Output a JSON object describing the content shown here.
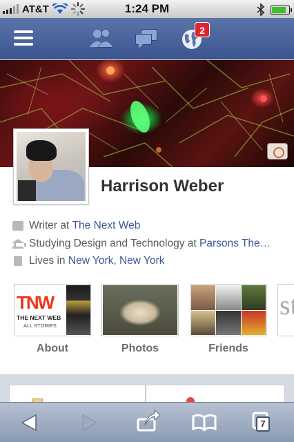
{
  "status_bar": {
    "carrier": "AT&T",
    "time": "1:24 PM",
    "battery_percent": 0.85
  },
  "top_bar": {
    "menu_icon": "hamburger-menu-icon",
    "friends_icon": "friend-requests-icon",
    "messages_icon": "messages-icon",
    "notifications_icon": "globe-notifications-icon",
    "notification_count": "2",
    "accent_color": "#3b5998"
  },
  "profile": {
    "name": "Harrison Weber",
    "work_prefix": "Writer at",
    "work_link": "The Next Web",
    "study_prefix": "Studying Design and Technology at",
    "study_link": "Parsons The…",
    "lives_prefix": "Lives in",
    "lives_link": "New York, New York"
  },
  "tiles": {
    "about_label": "About",
    "photos_label": "Photos",
    "friends_label": "Friends",
    "about_thumb": {
      "logo": "TNW",
      "line1": "THE NEXT WEB",
      "line2": "ALL STORIES"
    },
    "more_thumb_text": "sty"
  },
  "safari_toolbar": {
    "back_icon": "back-arrow-icon",
    "forward_icon": "forward-arrow-icon",
    "share_icon": "share-icon",
    "bookmarks_icon": "bookmarks-icon",
    "pages_icon": "pages-icon",
    "pages_count": "7"
  }
}
